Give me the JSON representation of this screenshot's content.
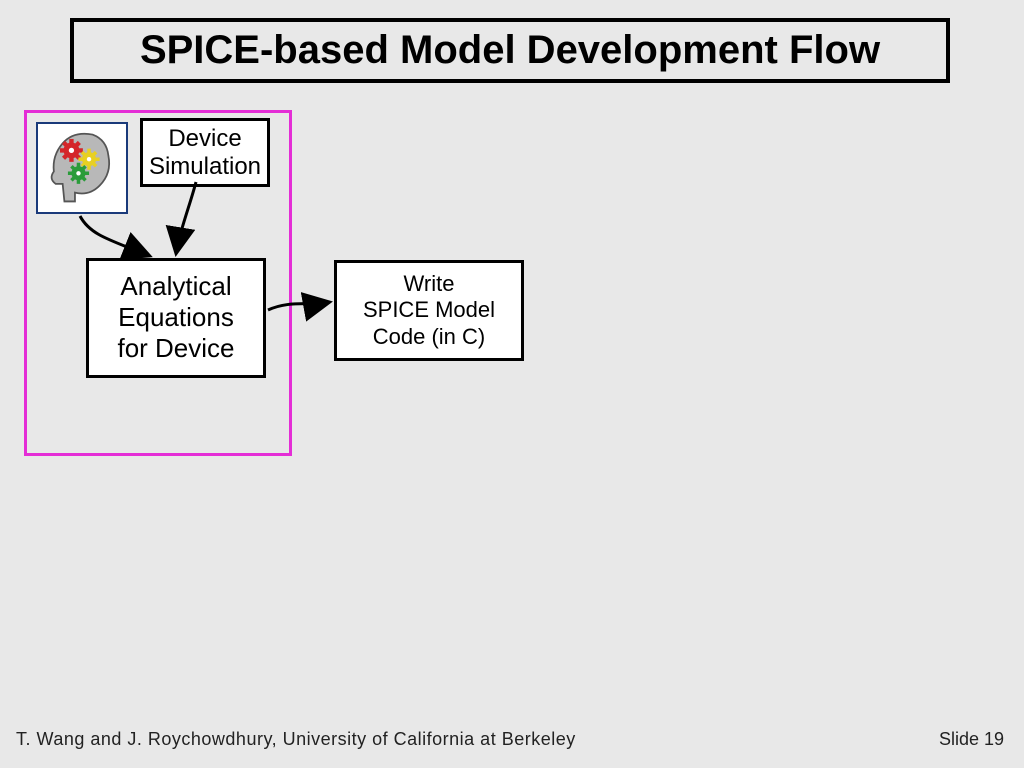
{
  "title": "SPICE-based Model Development Flow",
  "boxes": {
    "brain_icon_name": "brain-gears",
    "device_simulation": "Device\nSimulation",
    "analytical": "Analytical\nEquations\nfor Device",
    "spice": "Write\nSPICE Model\nCode (in C)"
  },
  "footer": {
    "left": "T. Wang and J. Roychowdhury,  University of California  at Berkeley",
    "right": "Slide 19"
  }
}
